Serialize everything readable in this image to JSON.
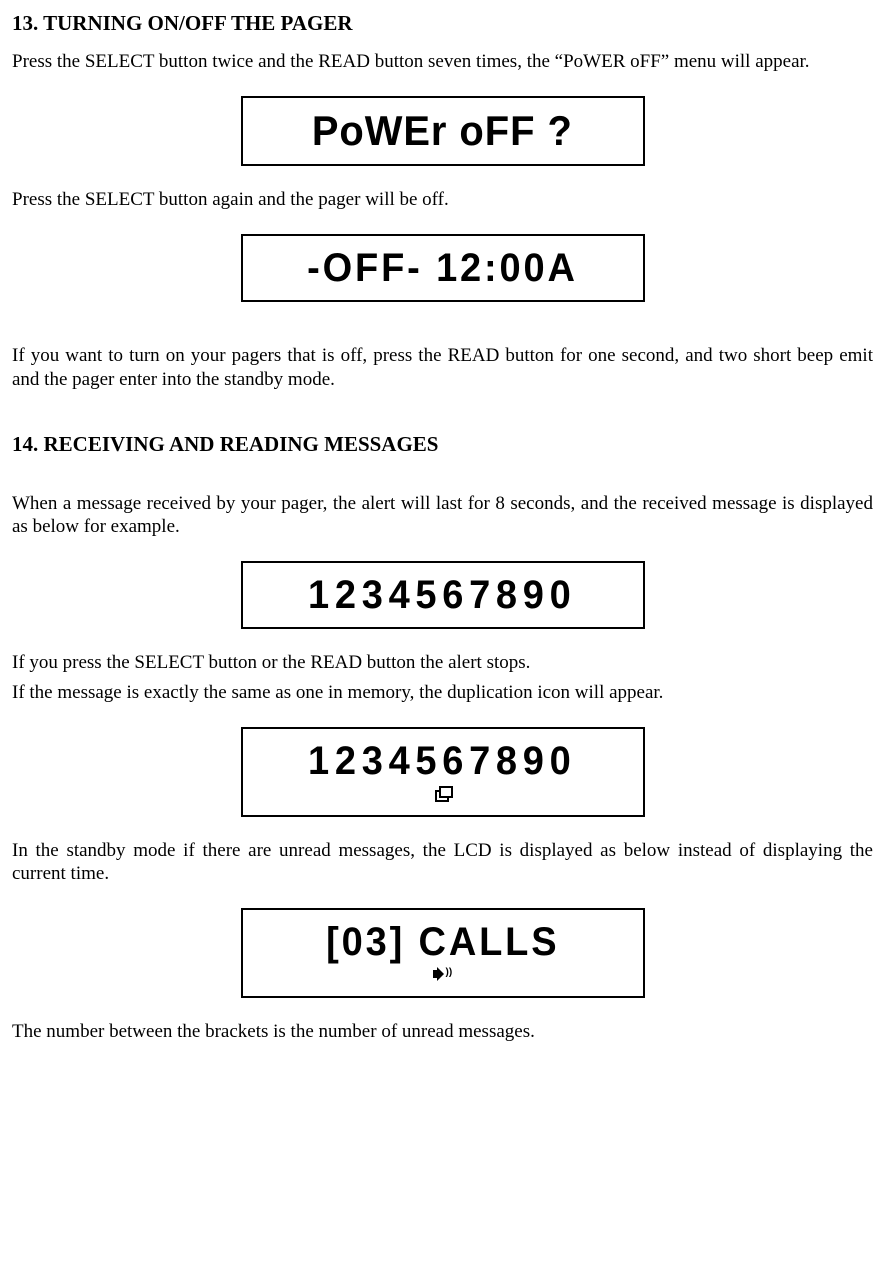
{
  "section13": {
    "title": "13. TURNING ON/OFF  THE PAGER",
    "para1": "Press the SELECT button twice and the READ button seven times, the “PoWER oFF” menu will appear.",
    "lcd1": "PoWEr  oFF ?",
    "para2": "Press the SELECT button again and the pager will be off.",
    "lcd2": "-OFF-   12:00A",
    "para3": "If you want to turn on your pagers that is off, press the READ button for one second, and two short beep emit and the pager enter into the standby mode."
  },
  "section14": {
    "title": "14. RECEIVING AND READING MESSAGES",
    "para1": "When a message received by your pager, the alert will last for 8 seconds, and the received message is displayed as below for example.",
    "lcd1": "1234567890",
    "para2a": "If you press the SELECT button or the READ button the alert stops.",
    "para2b": "If the message is exactly the same as one in memory, the duplication icon will appear.",
    "lcd2": "1234567890",
    "para3": "In the standby mode if there are unread messages, the LCD is displayed as below instead of displaying the current time.",
    "lcd3": "[03]  CALLS",
    "para4": "The number between the brackets is the number of unread messages."
  }
}
